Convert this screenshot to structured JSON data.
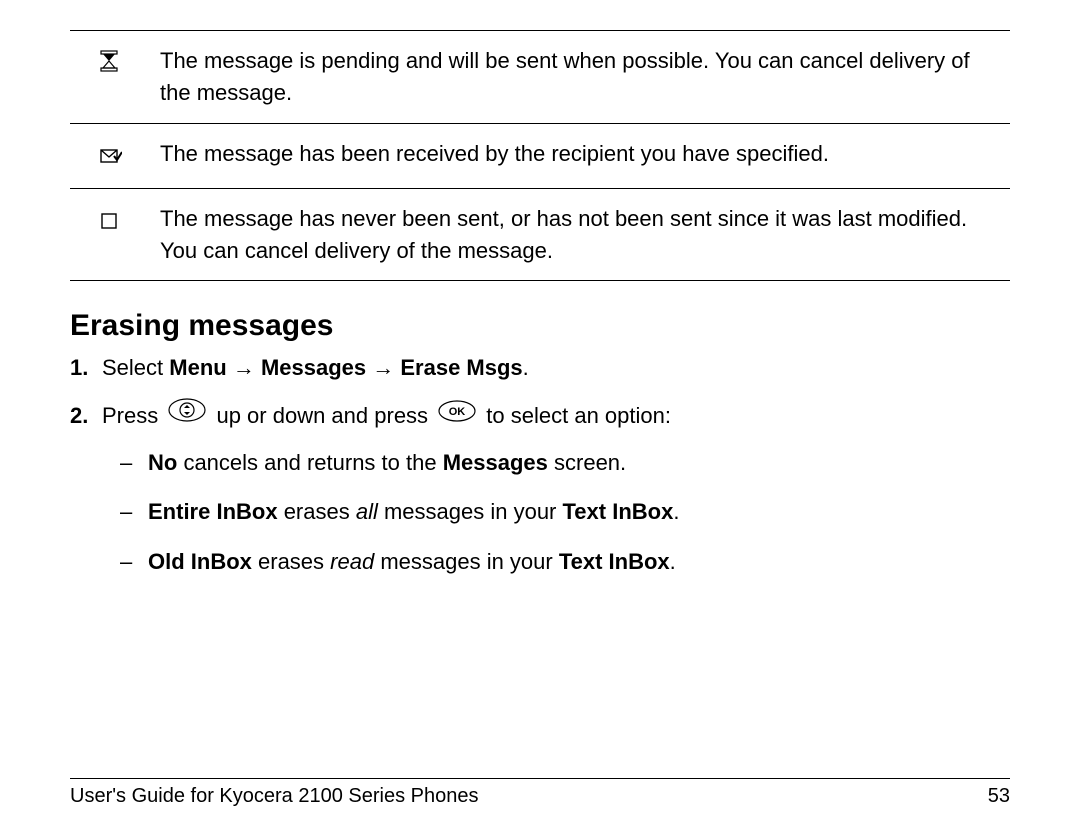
{
  "status": [
    {
      "icon": "hourglass-icon",
      "text": "The message is pending and will be sent when possible. You can cancel delivery of the message."
    },
    {
      "icon": "envelope-check-icon",
      "text": "The message has been received by the recipient you have specified."
    },
    {
      "icon": "empty-box-icon",
      "text": "The message has never been sent, or has not been sent since it was last modified. You can cancel delivery of the message."
    }
  ],
  "heading": "Erasing messages",
  "step1": {
    "num": "1.",
    "pre": "Select ",
    "menu": "Menu",
    "arrow1": " → ",
    "messages": "Messages",
    "arrow2": " → ",
    "erase": "Erase Msgs",
    "dot": "."
  },
  "step2": {
    "num": "2.",
    "pre": "Press ",
    "mid": " up or down and press ",
    "post": " to select an option:"
  },
  "sub": [
    {
      "dash": "–",
      "bold": "No",
      "text": " cancels and returns to the ",
      "bold2": "Messages",
      "tail": " screen."
    },
    {
      "dash": "–",
      "bold": "Entire InBox",
      "text": " erases ",
      "ital": "all",
      "text2": " messages in your ",
      "bold2": "Text InBox",
      "tail": "."
    },
    {
      "dash": "–",
      "bold": "Old InBox",
      "text": " erases ",
      "ital": "read",
      "text2": " messages in your ",
      "bold2": "Text InBox",
      "tail": "."
    }
  ],
  "footer": {
    "title": "User's Guide for Kyocera 2100 Series Phones",
    "page": "53"
  }
}
